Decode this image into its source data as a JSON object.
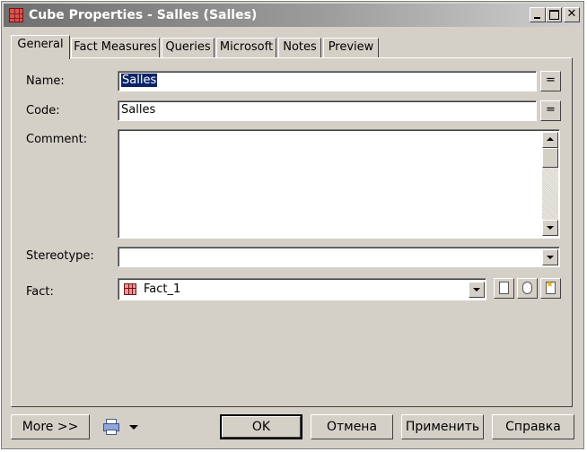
{
  "window": {
    "title": "Cube Properties - Salles (Salles)"
  },
  "tabs": [
    {
      "label": "General",
      "active": true
    },
    {
      "label": "Fact Measures",
      "active": false
    },
    {
      "label": "Queries",
      "active": false
    },
    {
      "label": "Microsoft",
      "active": false
    },
    {
      "label": "Notes",
      "active": false
    },
    {
      "label": "Preview",
      "active": false
    }
  ],
  "general": {
    "name_label": "Name:",
    "name_value": "Salles",
    "code_label": "Code:",
    "code_value": "Salles",
    "comment_label": "Comment:",
    "comment_value": "",
    "stereotype_label": "Stereotype:",
    "stereotype_value": "",
    "fact_label": "Fact:",
    "fact_value": "Fact_1",
    "equals_symbol": "="
  },
  "footer": {
    "more_label": "More >>",
    "ok_label": "OK",
    "cancel_label": "Отмена",
    "apply_label": "Применить",
    "help_label": "Справка"
  },
  "icons": {
    "title": "cube-icon",
    "fact": "fact-table-icon",
    "print": "printer-icon"
  },
  "colors": {
    "titlebar": "#6f6f6f",
    "selection": "#0a246a",
    "face": "#d4d0c8"
  }
}
